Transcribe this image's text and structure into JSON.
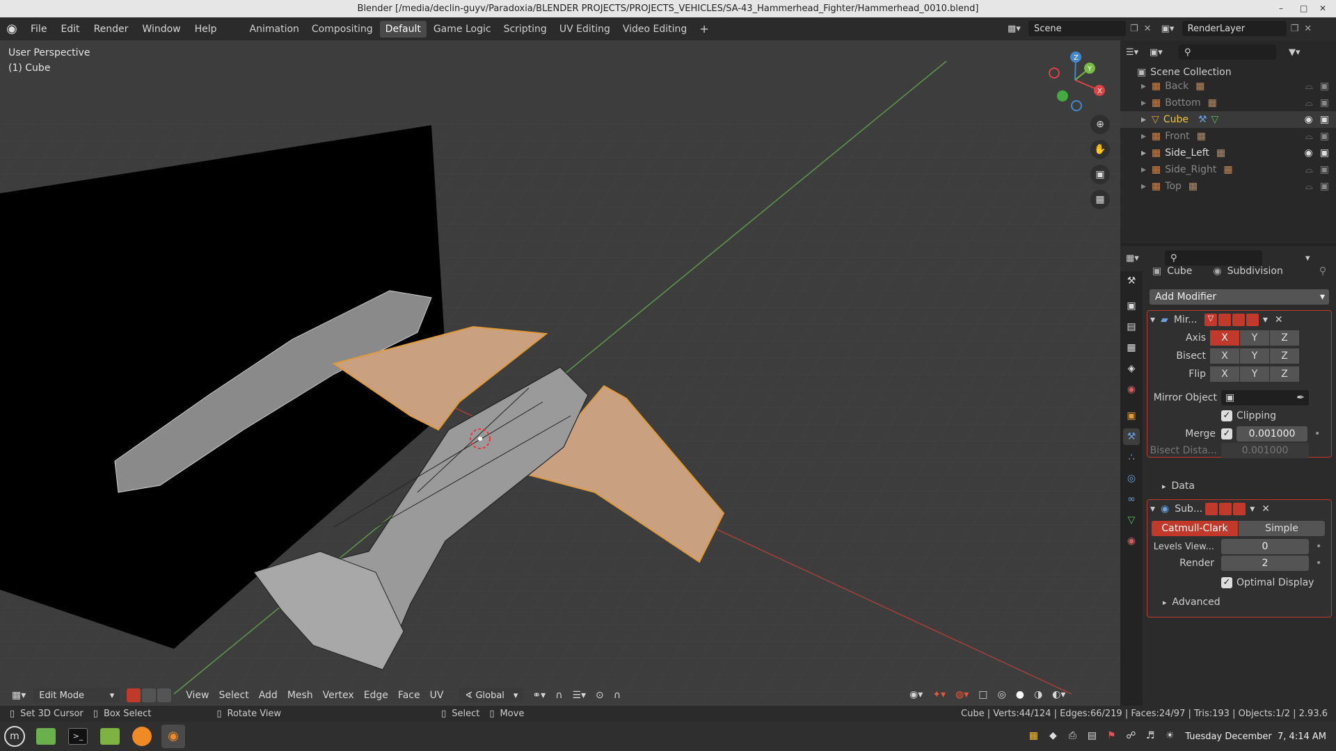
{
  "title_bar": {
    "text": "Blender [/media/declin-guyv/Paradoxia/BLENDER PROJECTS/PROJECTS_VEHICLES/SA-43_Hammerhead_Fighter/Hammerhead_0010.blend]"
  },
  "menu": [
    "File",
    "Edit",
    "Render",
    "Window",
    "Help"
  ],
  "workspaces": [
    "Animation",
    "Compositing",
    "Default",
    "Game Logic",
    "Scripting",
    "UV Editing",
    "Video Editing"
  ],
  "active_workspace": "Default",
  "scene": {
    "name": "Scene",
    "render_layer": "RenderLayer"
  },
  "viewport": {
    "perspective_label": "User Perspective",
    "object_label": "(1) Cube",
    "gizmo_axes": [
      "X",
      "Y",
      "Z"
    ]
  },
  "header3d": {
    "mode": "Edit Mode",
    "menus": [
      "View",
      "Select",
      "Add",
      "Mesh",
      "Vertex",
      "Edge",
      "Face",
      "UV"
    ],
    "orientation": "Global"
  },
  "status_bar": {
    "hints": [
      "Set 3D Cursor",
      "Box Select",
      "Rotate View",
      "Select",
      "Move"
    ],
    "stats": "Cube | Verts:44/124 | Edges:66/219 | Faces:24/97 | Tris:193 | Objects:1/2 | 2.93.6"
  },
  "outliner": {
    "collection": "Scene Collection",
    "items": [
      {
        "name": "Back",
        "active": false
      },
      {
        "name": "Bottom",
        "active": false
      },
      {
        "name": "Cube",
        "active": true
      },
      {
        "name": "Front",
        "active": false
      },
      {
        "name": "Side_Left",
        "active": false
      },
      {
        "name": "Side_Right",
        "active": false
      },
      {
        "name": "Top",
        "active": false
      }
    ]
  },
  "properties": {
    "object_name": "Cube",
    "modifier_context": "Subdivision",
    "add_modifier": "Add Modifier",
    "mirror": {
      "name": "Mir...",
      "axis_label": "Axis",
      "bisect_label": "Bisect",
      "flip_label": "Flip",
      "axes": [
        "X",
        "Y",
        "Z"
      ],
      "mirror_object_label": "Mirror Object",
      "clipping_label": "Clipping",
      "merge_label": "Merge",
      "merge_value": "0.001000",
      "bisect_distance_label": "Bisect Dista...",
      "bisect_distance_value": "0.001000",
      "data_label": "Data"
    },
    "subdivision": {
      "name": "Sub...",
      "catmull": "Catmull-Clark",
      "simple": "Simple",
      "levels_viewport_label": "Levels View...",
      "levels_viewport_value": "0",
      "render_label": "Render",
      "render_value": "2",
      "optimal_display_label": "Optimal Display",
      "advanced_label": "Advanced"
    }
  },
  "taskbar": {
    "clock": "Tuesday December  7, 4:14 AM"
  },
  "colors": {
    "accent": "#c0392b",
    "selection": "#e09a3a",
    "viewport_bg": "#3c3c3c",
    "active_item": "#f0c040"
  }
}
